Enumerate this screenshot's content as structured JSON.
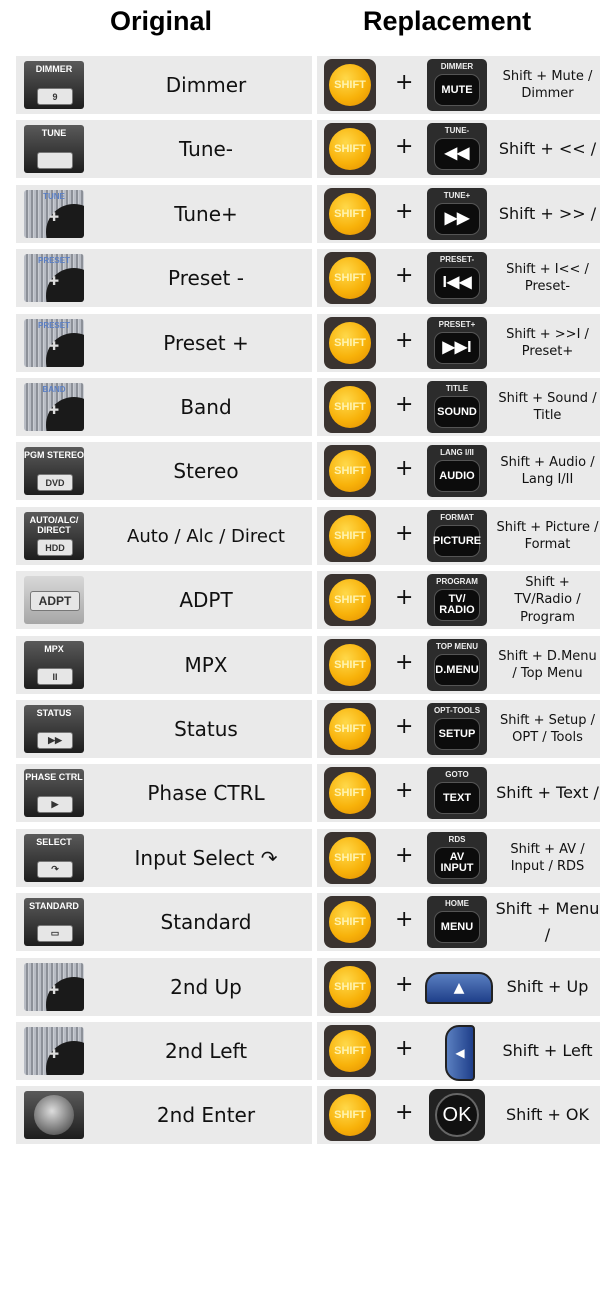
{
  "headers": {
    "original": "Original",
    "replacement": "Replacement"
  },
  "shift_label": "SHIFT",
  "plus": "+",
  "rows": [
    {
      "original": "Dimmer",
      "orig_icon": {
        "text": "DIMMER",
        "key": "9"
      },
      "button": {
        "top": "DIMMER",
        "key": "MUTE"
      },
      "replacement": "Shift + Mute / Dimmer"
    },
    {
      "original": "Tune-",
      "orig_icon": {
        "text": "TUNE"
      },
      "button": {
        "top": "TUNE-",
        "key": "◀◀"
      },
      "replacement": "Shift + << /"
    },
    {
      "original": "Tune+",
      "orig_icon": {
        "text": "TUNE"
      },
      "button": {
        "top": "TUNE+",
        "key": "▶▶"
      },
      "replacement": "Shift + >> /"
    },
    {
      "original": "Preset -",
      "orig_icon": {
        "text": "PRESET"
      },
      "button": {
        "top": "PRESET-",
        "key": "I◀◀"
      },
      "replacement": "Shift + I<< / Preset-"
    },
    {
      "original": "Preset +",
      "orig_icon": {
        "text": "PRESET"
      },
      "button": {
        "top": "PRESET+",
        "key": "▶▶I"
      },
      "replacement": "Shift + >>I / Preset+"
    },
    {
      "original": "Band",
      "orig_icon": {
        "text": "BAND"
      },
      "button": {
        "top": "TITLE",
        "key": "SOUND"
      },
      "replacement": "Shift + Sound / Title"
    },
    {
      "original": "Stereo",
      "orig_icon": {
        "text": "PGM STEREO",
        "key": "DVD"
      },
      "button": {
        "top": "LANG I/II",
        "key": "AUDIO"
      },
      "replacement": "Shift + Audio / Lang I/II"
    },
    {
      "original": "Auto / Alc / Direct",
      "orig_icon": {
        "text": "AUTO/ALC/ DIRECT",
        "key": "HDD"
      },
      "button": {
        "top": "FORMAT",
        "key": "PICTURE"
      },
      "replacement": "Shift + Picture / Format"
    },
    {
      "original": "ADPT",
      "orig_icon": {
        "text": "ADPT"
      },
      "button": {
        "top": "PROGRAM",
        "key": "TV/ RADIO"
      },
      "replacement": "Shift + TV/Radio / Program"
    },
    {
      "original": "MPX",
      "orig_icon": {
        "text": "MPX",
        "key": "II"
      },
      "button": {
        "top": "TOP MENU",
        "key": "D.MENU"
      },
      "replacement": "Shift + D.Menu / Top Menu"
    },
    {
      "original": "Status",
      "orig_icon": {
        "text": "STATUS",
        "key": "▶▶"
      },
      "button": {
        "top": "OPT-TOOLS",
        "key": "SETUP"
      },
      "replacement": "Shift + Setup / OPT / Tools"
    },
    {
      "original": "Phase CTRL",
      "orig_icon": {
        "text": "PHASE CTRL",
        "key": "▶"
      },
      "button": {
        "top": "GOTO",
        "key": "TEXT"
      },
      "replacement": "Shift + Text /"
    },
    {
      "original": "Input Select ↷",
      "orig_icon": {
        "text": "SELECT",
        "key": "↷"
      },
      "button": {
        "top": "RDS",
        "key": "AV INPUT"
      },
      "replacement": "Shift + AV / Input / RDS"
    },
    {
      "original": "Standard",
      "orig_icon": {
        "text": "STANDARD",
        "key": "▭"
      },
      "button": {
        "top": "HOME",
        "key": "MENU"
      },
      "replacement": "Shift + Menu /"
    },
    {
      "original": "2nd Up",
      "orig_icon": {
        "text": ""
      },
      "button": {
        "top": "",
        "key": "▲"
      },
      "replacement": "Shift + Up"
    },
    {
      "original": "2nd Left",
      "orig_icon": {
        "text": ""
      },
      "button": {
        "top": "",
        "key": "◀"
      },
      "replacement": "Shift + Left"
    },
    {
      "original": "2nd Enter",
      "orig_icon": {
        "text": ""
      },
      "button": {
        "top": "",
        "key": "OK"
      },
      "replacement": "Shift + OK"
    }
  ]
}
